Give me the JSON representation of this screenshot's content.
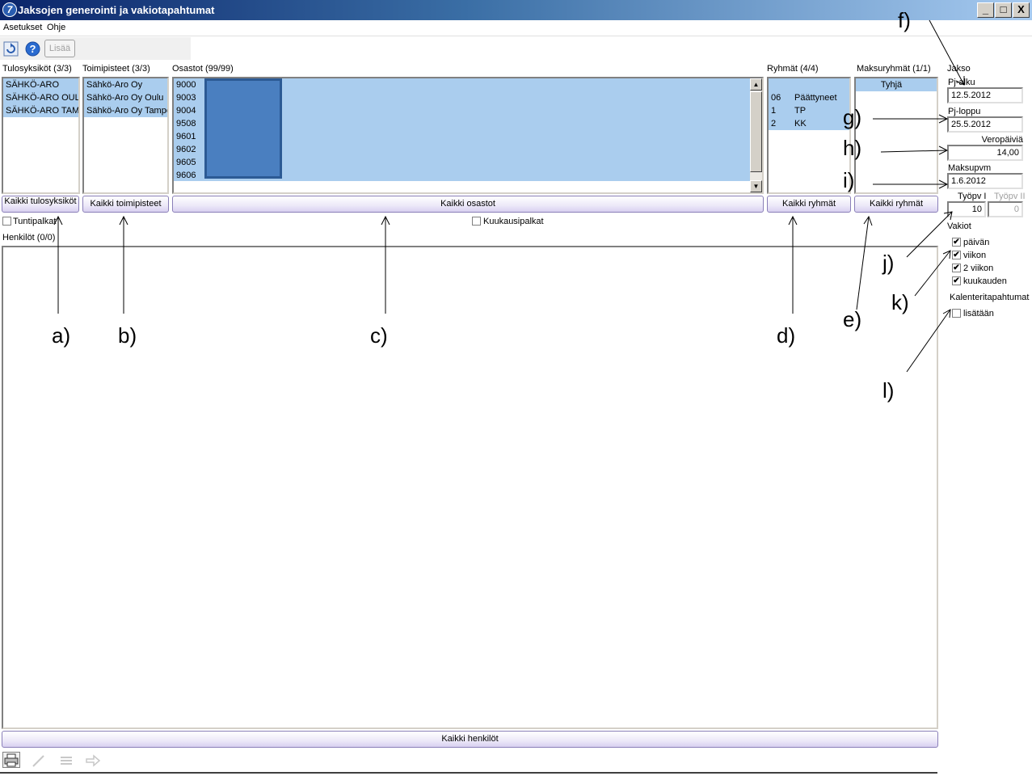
{
  "window": {
    "title": "Jaksojen generointi ja vakiotapahtumat",
    "minimize": "_",
    "maximize": "□",
    "close": "X"
  },
  "menu": {
    "items": [
      "Asetukset",
      "Ohje"
    ]
  },
  "toolbar": {
    "add_label": "Lisää"
  },
  "panels": {
    "tulosyksikot": {
      "label": "Tulosyksiköt (3/3)",
      "items": [
        "SÄHKÖ-ARO",
        "SÄHKÖ-ARO OULU",
        "SÄHKÖ-ARO TAMPI"
      ],
      "button": "Kaikki tulosyksiköt"
    },
    "toimipisteet": {
      "label": "Toimipisteet (3/3)",
      "items": [
        "Sähkö-Aro Oy",
        "Sähkö-Aro Oy Oulu",
        "Sähkö-Aro Oy Tamperi"
      ],
      "button": "Kaikki toimipisteet"
    },
    "osastot": {
      "label": "Osastot (99/99)",
      "items": [
        "9000",
        "9003",
        "9004",
        "9508",
        "9601",
        "9602",
        "9605",
        "9606"
      ],
      "button": "Kaikki osastot"
    },
    "ryhmat": {
      "label": "Ryhmät (4/4)",
      "items": [
        {
          "code": "06",
          "name": "Päättyneet"
        },
        {
          "code": "1",
          "name": "TP"
        },
        {
          "code": "2",
          "name": "KK"
        }
      ],
      "button": "Kaikki ryhmät"
    },
    "maksuryhmat": {
      "label": "Maksuryhmät (1/1)",
      "items": [
        "Tyhjä"
      ],
      "button": "Kaikki ryhmät"
    }
  },
  "checkboxes": {
    "tuntipalkat": "Tuntipalkat",
    "kuukausipalkat": "Kuukausipalkat"
  },
  "henkilot": {
    "label": "Henkilöt (0/0)",
    "button": "Kaikki henkilöt"
  },
  "jakso": {
    "label": "Jakso",
    "alku_label": "Pj-alku",
    "alku_value": "12.5.2012",
    "loppu_label": "Pj-loppu",
    "loppu_value": "25.5.2012",
    "veropaivia_label": "Veropäiviä",
    "veropaivia_value": "14,00",
    "maksupvm_label": "Maksupvm",
    "maksupvm_value": "1.6.2012",
    "tyopv1_label": "Työpv I",
    "tyopv1_value": "10",
    "tyopv2_label": "Työpv II",
    "tyopv2_value": "0"
  },
  "vakiot": {
    "label": "Vakiot",
    "items": [
      "päivän",
      "viikon",
      "2 viikon",
      "kuukauden"
    ],
    "checked": [
      true,
      true,
      true,
      true
    ]
  },
  "kalenteri": {
    "label": "Kalenteritapahtumat",
    "item": "lisätään",
    "checked": false
  },
  "annotations": [
    "a)",
    "b)",
    "c)",
    "d)",
    "e)",
    "f)",
    "g)",
    "h)",
    "i)",
    "j)",
    "k)",
    "l)"
  ],
  "icons": {
    "app": "seven-logo-icon",
    "refresh": "refresh-icon",
    "help": "help-icon",
    "print": "printer-icon",
    "edit": "pencil-icon",
    "list": "list-icon",
    "forward": "arrow-right-icon"
  },
  "colors": {
    "selection": "#aacdee",
    "selection_dark": "#4a7fc0",
    "title_start": "#0a246a",
    "title_end": "#a6caf0"
  }
}
